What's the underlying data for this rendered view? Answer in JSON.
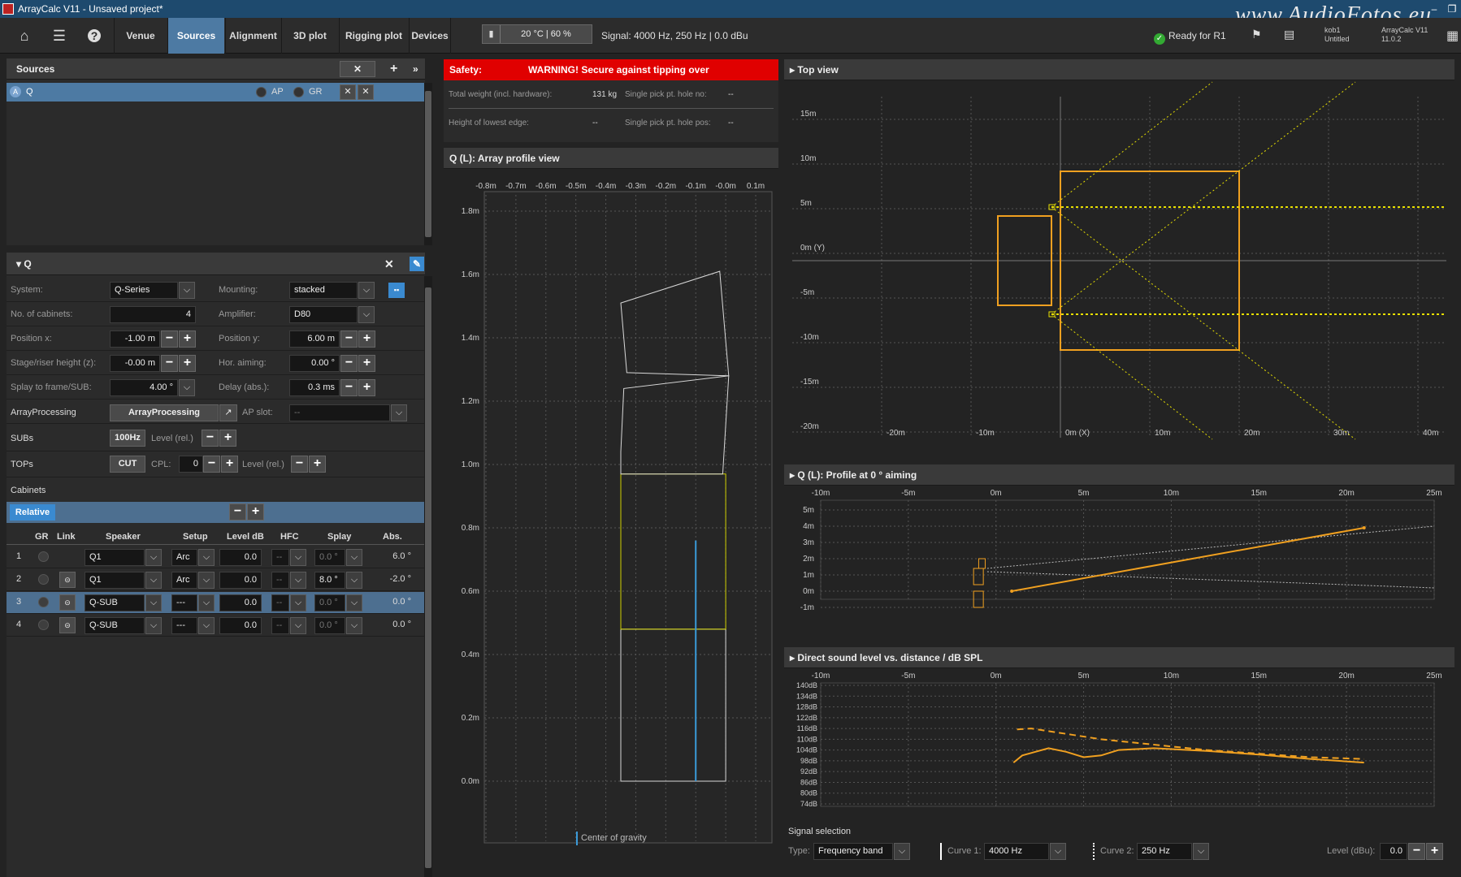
{
  "window": {
    "title": "ArrayCalc V11 - Unsaved project*",
    "watermark": "www.AudioFotos.eu"
  },
  "toolbar": {
    "tabs": [
      "Venue",
      "Sources",
      "Alignment",
      "3D plot",
      "Rigging plot",
      "Devices"
    ],
    "active_tab": "Sources",
    "temperature": "20 °C | 60 %",
    "signal": "Signal: 4000 Hz, 250 Hz | 0.0 dBu",
    "status": "Ready for R1",
    "user": "kob1",
    "project": "Untitled",
    "app_name": "ArrayCalc V11",
    "version": "11.0.2"
  },
  "sources": {
    "header": "Sources",
    "item": {
      "badge": "A",
      "name": "Q",
      "ap_label": "AP",
      "gr_label": "GR"
    }
  },
  "q_panel": {
    "header": "Q",
    "system_label": "System:",
    "system_value": "Q-Series",
    "mounting_label": "Mounting:",
    "mounting_value": "stacked",
    "cabinets_label": "No. of cabinets:",
    "cabinets_value": "4",
    "amplifier_label": "Amplifier:",
    "amplifier_value": "D80",
    "posx_label": "Position x:",
    "posx_value": "-1.00 m",
    "posy_label": "Position y:",
    "posy_value": "6.00 m",
    "stage_label": "Stage/riser height (z):",
    "stage_value": "-0.00 m",
    "hor_label": "Hor. aiming:",
    "hor_value": "0.00 °",
    "splay_label": "Splay to frame/SUB:",
    "splay_value": "4.00 °",
    "delay_label": "Delay (abs.):",
    "delay_value": "0.3 ms",
    "ap_label": "ArrayProcessing",
    "ap_btn": "ArrayProcessing",
    "apslot_label": "AP slot:",
    "apslot_value": "--",
    "subs_label": "SUBs",
    "subs_btn": "100Hz",
    "subs_level": "Level (rel.)",
    "tops_label": "TOPs",
    "tops_btn": "CUT",
    "tops_cpl": "CPL:",
    "tops_cpl_value": "0",
    "tops_level": "Level (rel.)",
    "cabinets_section": "Cabinets",
    "relative_btn": "Relative"
  },
  "cabinet_table": {
    "headers": [
      "GR",
      "Link",
      "Speaker",
      "Setup",
      "Level dB",
      "HFC",
      "Splay",
      "Abs."
    ],
    "rows": [
      {
        "n": "1",
        "speaker": "Q1",
        "setup": "Arc",
        "level": "0.0",
        "hfc": "--",
        "splay": "0.0 °",
        "abs": "6.0 °"
      },
      {
        "n": "2",
        "speaker": "Q1",
        "setup": "Arc",
        "level": "0.0",
        "hfc": "--",
        "splay": "8.0 °",
        "abs": "-2.0 °"
      },
      {
        "n": "3",
        "speaker": "Q-SUB",
        "setup": "---",
        "level": "0.0",
        "hfc": "--",
        "splay": "0.0 °",
        "abs": "0.0 °"
      },
      {
        "n": "4",
        "speaker": "Q-SUB",
        "setup": "---",
        "level": "0.0",
        "hfc": "--",
        "splay": "0.0 °",
        "abs": "0.0 °"
      }
    ]
  },
  "safety": {
    "label": "Safety:",
    "warning": "WARNING! Secure against tipping over",
    "weight_label": "Total weight (incl. hardware):",
    "weight_value": "131 kg",
    "pick_label": "Single pick pt. hole no:",
    "pick_value": "--",
    "lowest_label": "Height of lowest edge:",
    "lowest_value": "--",
    "pickpos_label": "Single pick pt. hole pos:",
    "pickpos_value": "--"
  },
  "profile_view": {
    "header": "Q (L): Array profile view",
    "xticks": [
      "-0.8m",
      "-0.7m",
      "-0.6m",
      "-0.5m",
      "-0.4m",
      "-0.3m",
      "-0.2m",
      "-0.1m",
      "-0.0m",
      "0.1m"
    ],
    "yticks": [
      "1.8m",
      "1.6m",
      "1.4m",
      "1.2m",
      "1.0m",
      "0.8m",
      "0.6m",
      "0.4m",
      "0.2m",
      "0.0m"
    ],
    "legend": "Center of gravity"
  },
  "top_view": {
    "header": "Top view",
    "xticks": [
      "-20m",
      "-10m",
      "0m (X)",
      "10m",
      "20m",
      "30m",
      "40m"
    ],
    "yticks": [
      "15m",
      "10m",
      "5m",
      "0m (Y)",
      "-5m",
      "-10m",
      "-15m",
      "-20m"
    ]
  },
  "aiming_profile": {
    "header": "Q (L): Profile at 0 ° aiming",
    "xticks": [
      "-10m",
      "-5m",
      "0m",
      "5m",
      "10m",
      "15m",
      "20m",
      "25m"
    ],
    "yticks": [
      "5m",
      "4m",
      "3m",
      "2m",
      "1m",
      "0m",
      "-1m"
    ]
  },
  "spl": {
    "header": "Direct sound level vs. distance / dB SPL",
    "xticks": [
      "-10m",
      "-5m",
      "0m",
      "5m",
      "10m",
      "15m",
      "20m",
      "25m"
    ],
    "yticks": [
      "140dB",
      "134dB",
      "128dB",
      "122dB",
      "116dB",
      "110dB",
      "104dB",
      "98dB",
      "92dB",
      "86dB",
      "80dB",
      "74dB"
    ]
  },
  "signal_selection": {
    "header": "Signal selection",
    "type_label": "Type:",
    "type_value": "Frequency band",
    "curve1_label": "Curve 1:",
    "curve1_value": "4000 Hz",
    "curve2_label": "Curve 2:",
    "curve2_value": "250 Hz",
    "level_label": "Level (dBu):",
    "level_value": "0.0"
  },
  "icons": {
    "home": "home-icon",
    "menu": "menu-icon",
    "help": "help-icon"
  },
  "colors": {
    "accent": "#4d7aa3",
    "warning": "#e00000",
    "plot_orange": "#f0a020",
    "plot_yellow": "#e8e000",
    "cog_blue": "#3a9ad9"
  }
}
